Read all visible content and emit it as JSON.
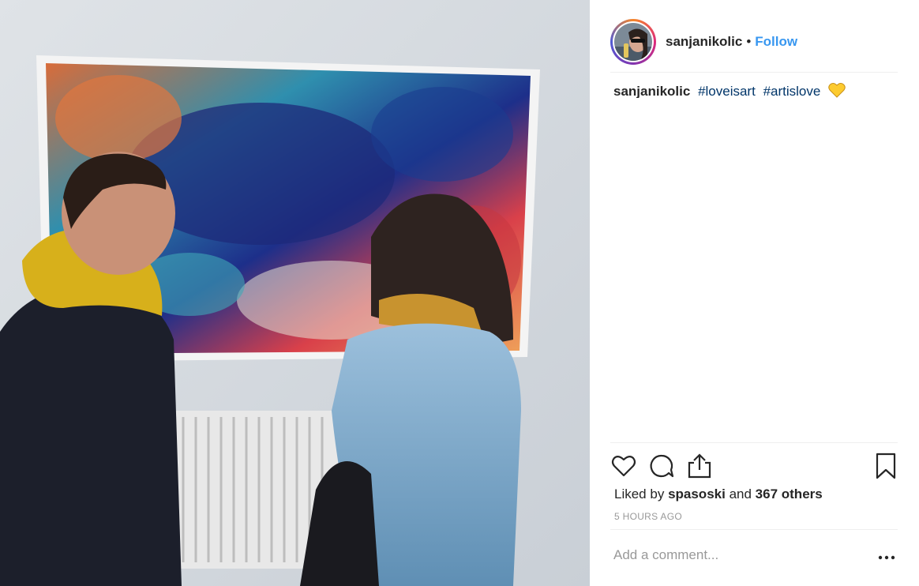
{
  "post": {
    "username": "sanjanikolic",
    "separator": "•",
    "follow_label": "Follow",
    "caption": {
      "username": "sanjanikolic",
      "hashtags": [
        "#loveisart",
        "#artislove"
      ],
      "emoji_icon": "yellow-heart-icon"
    },
    "likes": {
      "prefix": "Liked by",
      "user": "spasoski",
      "connector": "and",
      "others": "367 others"
    },
    "time": "5 HOURS AGO",
    "comment_placeholder": "Add a comment...",
    "icons": {
      "like": "heart-icon",
      "comment": "comment-bubble-icon",
      "share": "share-upload-icon",
      "save": "bookmark-icon",
      "more": "more-dots-icon"
    }
  },
  "colors": {
    "link_blue": "#3897f0",
    "hashtag": "#003569",
    "muted": "#999999",
    "divider": "#efefef"
  }
}
